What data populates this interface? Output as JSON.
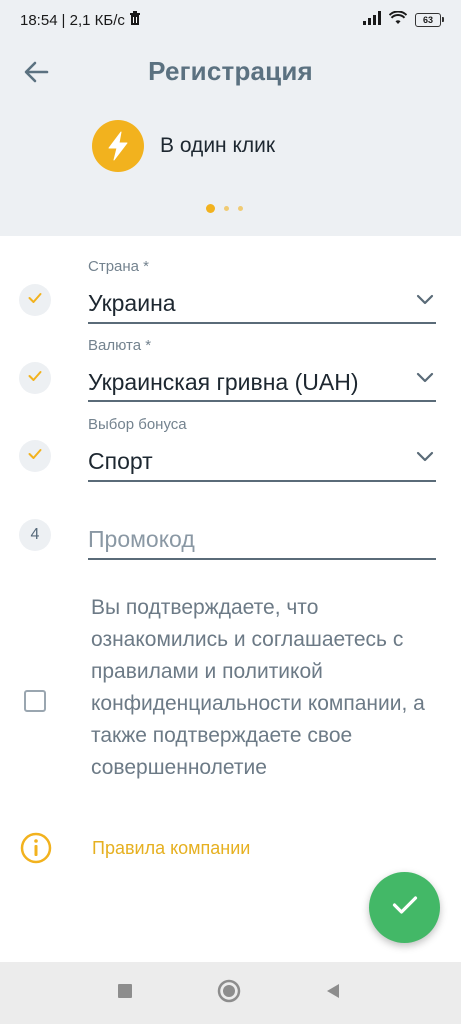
{
  "status_bar": {
    "time": "18:54",
    "network_speed": "| 2,1 КБ/с",
    "battery_level": "63"
  },
  "header": {
    "title": "Регистрация"
  },
  "registration_mode": {
    "icon": "lightning-icon",
    "label": "В один клик"
  },
  "pagination": {
    "active_index": 0,
    "count": 3
  },
  "form": {
    "country": {
      "label": "Страна *",
      "value": "Украина",
      "status": "check"
    },
    "currency": {
      "label": "Валюта *",
      "value": "Украинская гривна (UAH)",
      "status": "check"
    },
    "bonus": {
      "label": "Выбор бонуса",
      "value": "Спорт",
      "status": "check"
    },
    "promo": {
      "step": "4",
      "placeholder": "Промокод"
    }
  },
  "consent": {
    "checked": false,
    "text": "Вы подтверждаете, что ознакомились и соглашаетесь с правилами и политикой конфиденциальности компании, а также подтверждаете свое совершеннолетие"
  },
  "rules_link": {
    "label": "Правила компании"
  },
  "colors": {
    "accent": "#f2b21e",
    "submit": "#43b867",
    "title": "#5b7180",
    "header_bg": "#edf0f3"
  }
}
